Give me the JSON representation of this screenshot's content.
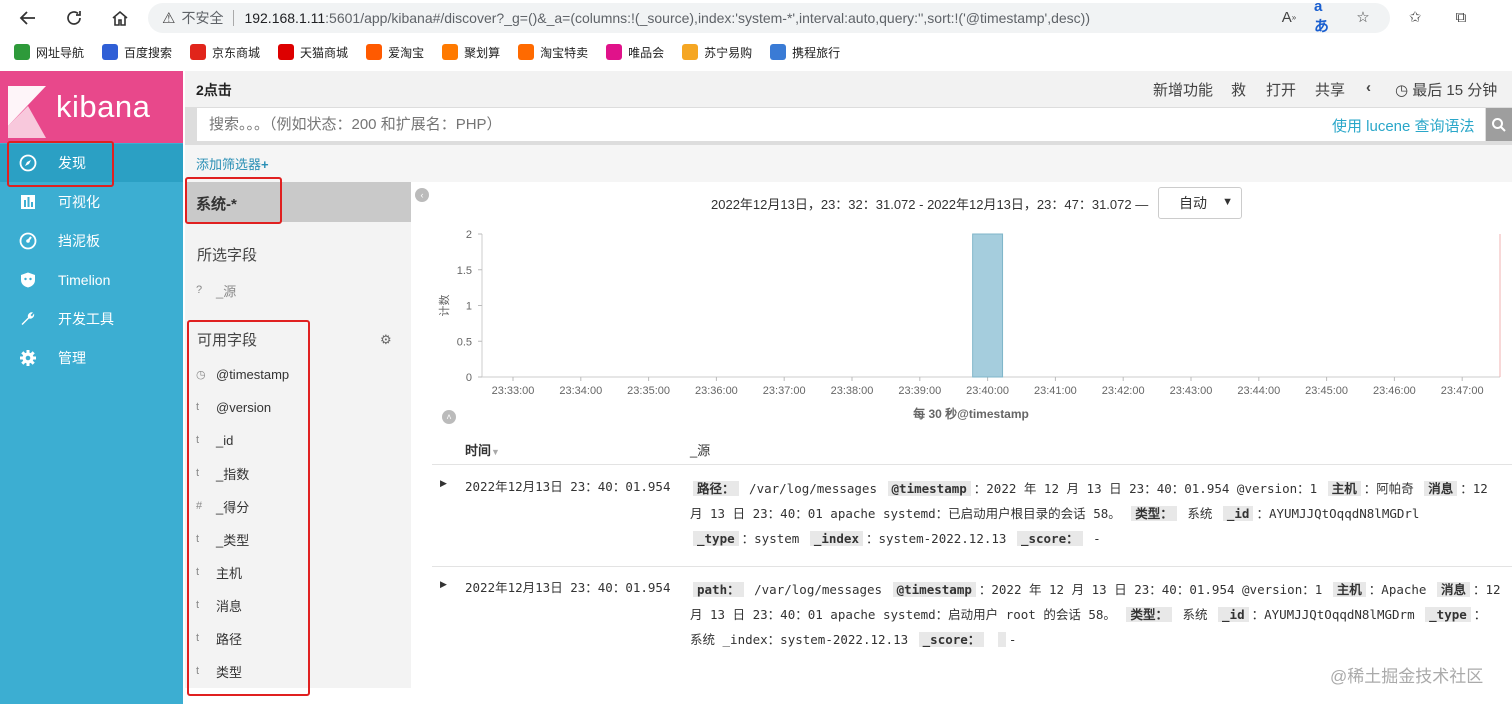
{
  "browser": {
    "insecure_label": "不安全",
    "url_host": "192.168.1.11",
    "url_path": ":5601/app/kibana#/discover?_g=()&_a=(columns:!(_source),index:'system-*',interval:auto,query:'',sort:!('@timestamp',desc))",
    "bookmarks": [
      {
        "label": "网址导航",
        "color": "#2e9a3a"
      },
      {
        "label": "百度搜索",
        "color": "#2f5fd6"
      },
      {
        "label": "京东商城",
        "color": "#e1251b"
      },
      {
        "label": "天猫商城",
        "color": "#d00"
      },
      {
        "label": "爱淘宝",
        "color": "#ff5a00"
      },
      {
        "label": "聚划算",
        "color": "#ff7a00"
      },
      {
        "label": "淘宝特卖",
        "color": "#ff6a00"
      },
      {
        "label": "唯品会",
        "color": "#e0128a"
      },
      {
        "label": "苏宁易购",
        "color": "#f5a623"
      },
      {
        "label": "携程旅行",
        "color": "#3a7bd5"
      }
    ]
  },
  "kibana": {
    "brand": "kibana",
    "nav": [
      {
        "label": "发现",
        "icon": "compass-icon"
      },
      {
        "label": "可视化",
        "icon": "bar-chart-icon"
      },
      {
        "label": "挡泥板",
        "icon": "dashboard-icon"
      },
      {
        "label": "Timelion",
        "icon": "shield-icon"
      },
      {
        "label": "开发工具",
        "icon": "wrench-icon"
      },
      {
        "label": "管理",
        "icon": "gear-icon"
      }
    ],
    "page_title": "2点击",
    "menu": {
      "new": "新增功能",
      "save": "救",
      "open": "打开",
      "share": "共享",
      "time": "最后 15 分钟"
    },
    "search": {
      "placeholder": "搜索。。。（例如状态：200 和扩展名：PHP）",
      "lucene": "使用 lucene 查询语法"
    },
    "add_filter": "添加筛选器",
    "index_pattern": "系统-*",
    "selected_fields_title": "所选字段",
    "selected_fields": [
      {
        "type": "?",
        "name": "_源"
      }
    ],
    "available_fields_title": "可用字段",
    "available_fields": [
      {
        "type": "◷",
        "name": "@timestamp"
      },
      {
        "type": "t",
        "name": "@version"
      },
      {
        "type": "t",
        "name": "_id"
      },
      {
        "type": "t",
        "name": "_指数"
      },
      {
        "type": "#",
        "name": "_得分"
      },
      {
        "type": "t",
        "name": "_类型"
      },
      {
        "type": "t",
        "name": "主机"
      },
      {
        "type": "t",
        "name": "消息"
      },
      {
        "type": "t",
        "name": "路径"
      },
      {
        "type": "t",
        "name": "类型"
      }
    ],
    "time_range": "2022年12月13日，23：32：31.072 - 2022年12月13日，23：47：31.072 —",
    "interval": "自动",
    "table": {
      "col_time": "时间",
      "col_source": "_源",
      "rows": [
        {
          "time": "2022年12月13日 23：40：01.954",
          "lines": [
            [
              [
                "k",
                "路径："
              ],
              [
                "v",
                " /var/log/messages "
              ],
              [
                "k",
                "@timestamp"
              ],
              [
                "v",
                "：2022 年 12 月 13 日 23：40：01.954 @version：1 "
              ],
              [
                "k",
                "主机"
              ],
              [
                "v",
                "：阿帕奇 "
              ],
              [
                "k",
                "消息"
              ],
              [
                "v",
                "：12"
              ]
            ],
            [
              [
                "v",
                "月 13 日 23：40：01 apache systemd：已启动用户根目录的会话 58。 "
              ],
              [
                "k",
                "类型："
              ],
              [
                "v",
                " 系统 "
              ],
              [
                "k",
                "_id"
              ],
              [
                "v",
                "：AYUMJJQtOqqdN8lMGDrl"
              ]
            ],
            [
              [
                "k",
                "_type"
              ],
              [
                "v",
                "：system "
              ],
              [
                "k",
                "_index"
              ],
              [
                "v",
                "：system-2022.12.13 "
              ],
              [
                "k",
                "_score："
              ],
              [
                "v",
                "  -"
              ]
            ]
          ]
        },
        {
          "time": "2022年12月13日 23：40：01.954",
          "lines": [
            [
              [
                "k",
                "path："
              ],
              [
                "v",
                " /var/log/messages "
              ],
              [
                "k",
                "@timestamp"
              ],
              [
                "v",
                "：2022 年 12 月 13 日 23：40：01.954 @version：1 "
              ],
              [
                "k",
                "主机"
              ],
              [
                "v",
                "：Apache "
              ],
              [
                "k",
                "消息"
              ],
              [
                "v",
                "：12"
              ]
            ],
            [
              [
                "v",
                "月 13 日 23：40：01 apache systemd：启动用户 root 的会话 58。 "
              ],
              [
                "k",
                "类型："
              ],
              [
                "v",
                " 系统 "
              ],
              [
                "k",
                "_id"
              ],
              [
                "v",
                "：AYUMJJQtOqqdN8lMGDrm "
              ],
              [
                "k",
                "_type"
              ],
              [
                "v",
                "："
              ]
            ],
            [
              [
                "v",
                "系统 _index：system-2022.12.13 "
              ],
              [
                "k",
                "_score："
              ],
              [
                "v",
                " "
              ],
              [
                "k",
                " "
              ],
              [
                "v",
                " -"
              ]
            ]
          ]
        }
      ]
    },
    "watermark": "@稀土掘金技术社区"
  },
  "chart_data": {
    "type": "bar",
    "xlabel": "每 30 秒@timestamp",
    "ylabel": "计数",
    "ylim": [
      0,
      2
    ],
    "yticks": [
      "0",
      "0.5",
      "1",
      "1.5",
      "2"
    ],
    "xticks": [
      "23:33:00",
      "23:34:00",
      "23:35:00",
      "23:36:00",
      "23:37:00",
      "23:38:00",
      "23:39:00",
      "23:40:00",
      "23:41:00",
      "23:42:00",
      "23:43:00",
      "23:44:00",
      "23:45:00",
      "23:46:00",
      "23:47:00"
    ],
    "bars": [
      {
        "x": "23:40:00",
        "value": 2
      }
    ],
    "bar_color": "#a5cddd"
  }
}
